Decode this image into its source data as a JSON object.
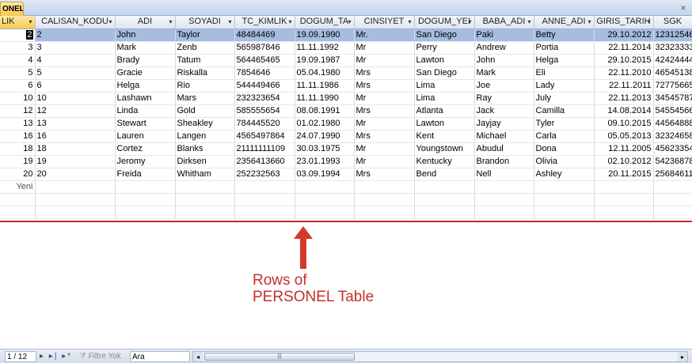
{
  "tab": {
    "title": "ONEL",
    "close_glyph": "×"
  },
  "columns": [
    {
      "label": "LIK"
    },
    {
      "label": "CALISAN_KODU"
    },
    {
      "label": "ADI"
    },
    {
      "label": "SOYADI"
    },
    {
      "label": "TC_KIMLIK"
    },
    {
      "label": "DOGUM_TA"
    },
    {
      "label": "CINSIYET"
    },
    {
      "label": "DOGUM_YEI"
    },
    {
      "label": "BABA_ADI"
    },
    {
      "label": "ANNE_ADI"
    },
    {
      "label": "GIRIS_TARIH"
    },
    {
      "label": "SGK"
    }
  ],
  "rows": [
    [
      "2",
      "2",
      "John",
      "Taylor",
      "48484469",
      "19.09.1990",
      "Mr.",
      "San Diego",
      "Paki",
      "Betty",
      "29.10.2012",
      "12312546"
    ],
    [
      "3",
      "3",
      "Mark",
      "Zenb",
      "565987846",
      "11.11.1992",
      "Mr",
      "Perry",
      "Andrew",
      "Portia",
      "22.11.2014",
      "32323333"
    ],
    [
      "4",
      "4",
      "Brady",
      "Tatum",
      "564465465",
      "19.09.1987",
      "Mr",
      "Lawton",
      "John",
      "Helga",
      "29.10.2015",
      "42424444"
    ],
    [
      "5",
      "5",
      "Gracie",
      "Riskalla",
      "7854646",
      "05.04.1980",
      "Mrs",
      "San Diego",
      "Mark",
      "Eli",
      "22.11.2010",
      "46545138"
    ],
    [
      "6",
      "6",
      "Helga",
      "Rio",
      "544449466",
      "11.11.1986",
      "Mrs",
      "Lima",
      "Joe",
      "Lady",
      "22.11.2011",
      "72775665"
    ],
    [
      "10",
      "10",
      "Lashawn",
      "Mars",
      "232323654",
      "11.11.1990",
      "Mr",
      "Lima",
      "Ray",
      "July",
      "22.11.2013",
      "34545787"
    ],
    [
      "12",
      "12",
      "Linda",
      "Gold",
      "585555654",
      "08.08.1991",
      "Mrs",
      "Atlanta",
      "Jack",
      "Camilla",
      "14.08.2014",
      "54554566"
    ],
    [
      "13",
      "13",
      "Stewart",
      "Sheakley",
      "784445520",
      "01.02.1980",
      "Mr",
      "Lawton",
      "Jayjay",
      "Tyler",
      "09.10.2015",
      "44564888"
    ],
    [
      "16",
      "16",
      "Lauren",
      "Langen",
      "4565497864",
      "24.07.1990",
      "Mrs",
      "Kent",
      "Michael",
      "Carla",
      "05.05.2013",
      "32324658"
    ],
    [
      "18",
      "18",
      "Cortez",
      "Blanks",
      "21111111109",
      "30.03.1975",
      "Mr",
      "Youngstown",
      "Abudul",
      "Dona",
      "12.11.2005",
      "45623354"
    ],
    [
      "19",
      "19",
      "Jeromy",
      "Dirksen",
      "2356413660",
      "23.01.1993",
      "Mr",
      "Kentucky",
      "Brandon",
      "Olivia",
      "02.10.2012",
      "54236878"
    ],
    [
      "20",
      "20",
      "Freida",
      "Whitham",
      "252232563",
      "03.09.1994",
      "Mrs",
      "Bend",
      "Nell",
      "Ashley",
      "20.11.2015",
      "25684611"
    ]
  ],
  "new_row_label": "Yeni",
  "annotation": {
    "line1": "Rows of",
    "line2": "PERSONEL Table",
    "color": "#c4302b"
  },
  "navbar": {
    "record_position": "1 / 12",
    "nav_buttons": "▸ ▸| ▸*",
    "filter_icon": "filter-icon",
    "filter_label": "Filtre Yok",
    "search_value": "Ara",
    "scroll_left": "◂",
    "scroll_right": "▸",
    "scroll_grip": "|||"
  },
  "colors": {
    "selected_row": "#a6bce0",
    "header_active": "#f7c94a",
    "annotation_line": "#c0282c"
  }
}
